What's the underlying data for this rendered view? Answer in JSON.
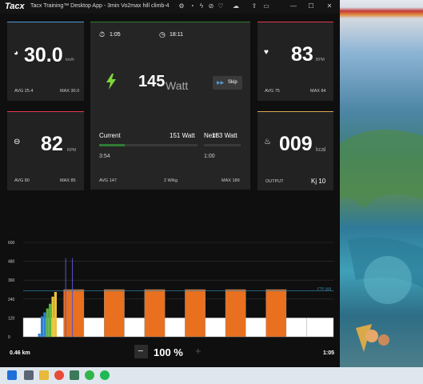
{
  "window": {
    "logo": "Tacx",
    "title": "Tacx Training™ Desktop App - 3min Vo2max hill climb-4"
  },
  "colors": {
    "speed": "#4f9bd9",
    "heart": "#e53950",
    "cadence": "#e53950",
    "energy": "#d9a94a",
    "power": "#2e7d32",
    "bar_orange": "#e8701f",
    "bar_blue": "#2f7fd0",
    "bar_green": "#5cb33d",
    "bar_yellow": "#e8c33a"
  },
  "speed": {
    "value": "30.0",
    "unit": "km/h",
    "avg": "AVG 25.4",
    "max": "MAX 30.0",
    "icon": "speedometer-icon"
  },
  "heart_rate": {
    "value": "83",
    "unit": "BPM",
    "avg": "AVG 75",
    "max": "MAX 84",
    "icon": "heart-icon"
  },
  "cadence": {
    "value": "82",
    "unit": "RPM",
    "avg": "AVG 80",
    "max": "MAX 85",
    "icon": "cadence-icon"
  },
  "energy": {
    "value": "009",
    "unit": "kcal",
    "label": "OUTPUT",
    "kj": "Kj 10",
    "icon": "flame-icon"
  },
  "center": {
    "elapsed": "1:05",
    "remaining": "18:11",
    "power_value": "145",
    "power_unit": "Watt",
    "skip": "Skip",
    "current_label": "Current",
    "current_watt": "151 Watt",
    "next_label": "Next",
    "next_watt": "183 Watt",
    "current_time": "3:54",
    "next_time": "1:00",
    "current_progress": 0.26,
    "avg": "AVG 147",
    "wkg": "2 W/kg",
    "max": "MAX 189"
  },
  "chart_data": {
    "type": "bar",
    "ylim": [
      0,
      600
    ],
    "yticks": [
      "600",
      "480",
      "360",
      "240",
      "120",
      "0"
    ],
    "ftp_value": 293,
    "ftp_label": "FTP 293",
    "segments": [
      {
        "from": 0.0,
        "to": 4.0,
        "watts": 120
      },
      {
        "from": 4.0,
        "to": 6.0,
        "watts": 120
      },
      {
        "from": 6.0,
        "to": 9.0,
        "watts": 300
      },
      {
        "from": 9.0,
        "to": 12.0,
        "watts": 120
      },
      {
        "from": 12.0,
        "to": 15.0,
        "watts": 300
      },
      {
        "from": 15.0,
        "to": 18.0,
        "watts": 120
      },
      {
        "from": 18.0,
        "to": 21.0,
        "watts": 300
      },
      {
        "from": 21.0,
        "to": 24.0,
        "watts": 120
      },
      {
        "from": 24.0,
        "to": 27.0,
        "watts": 300
      },
      {
        "from": 27.0,
        "to": 30.0,
        "watts": 120
      },
      {
        "from": 30.0,
        "to": 33.0,
        "watts": 300
      },
      {
        "from": 33.0,
        "to": 36.0,
        "watts": 120
      },
      {
        "from": 36.0,
        "to": 39.0,
        "watts": 300
      },
      {
        "from": 39.0,
        "to": 42.0,
        "watts": 120
      },
      {
        "from": 42.0,
        "to": 46.0,
        "watts": 120
      }
    ],
    "ridden": [
      {
        "at": 2.2,
        "watts": 20,
        "color": "#2f7fd0"
      },
      {
        "at": 2.6,
        "watts": 130,
        "color": "#2f7fd0"
      },
      {
        "at": 3.0,
        "watts": 155,
        "color": "#2f7fd0"
      },
      {
        "at": 3.4,
        "watts": 180,
        "color": "#5cb33d"
      },
      {
        "at": 3.8,
        "watts": 210,
        "color": "#5cb33d"
      },
      {
        "at": 4.2,
        "watts": 255,
        "color": "#e8c33a"
      },
      {
        "at": 4.6,
        "watts": 285,
        "color": "#e8c33a"
      }
    ],
    "markers": [
      6.3,
      7.3
    ],
    "x_range": [
      0,
      46
    ]
  },
  "bottom": {
    "distance": "0.46 km",
    "zoom": "100 %",
    "minus": "−",
    "plus": "+",
    "time": "1:05"
  }
}
